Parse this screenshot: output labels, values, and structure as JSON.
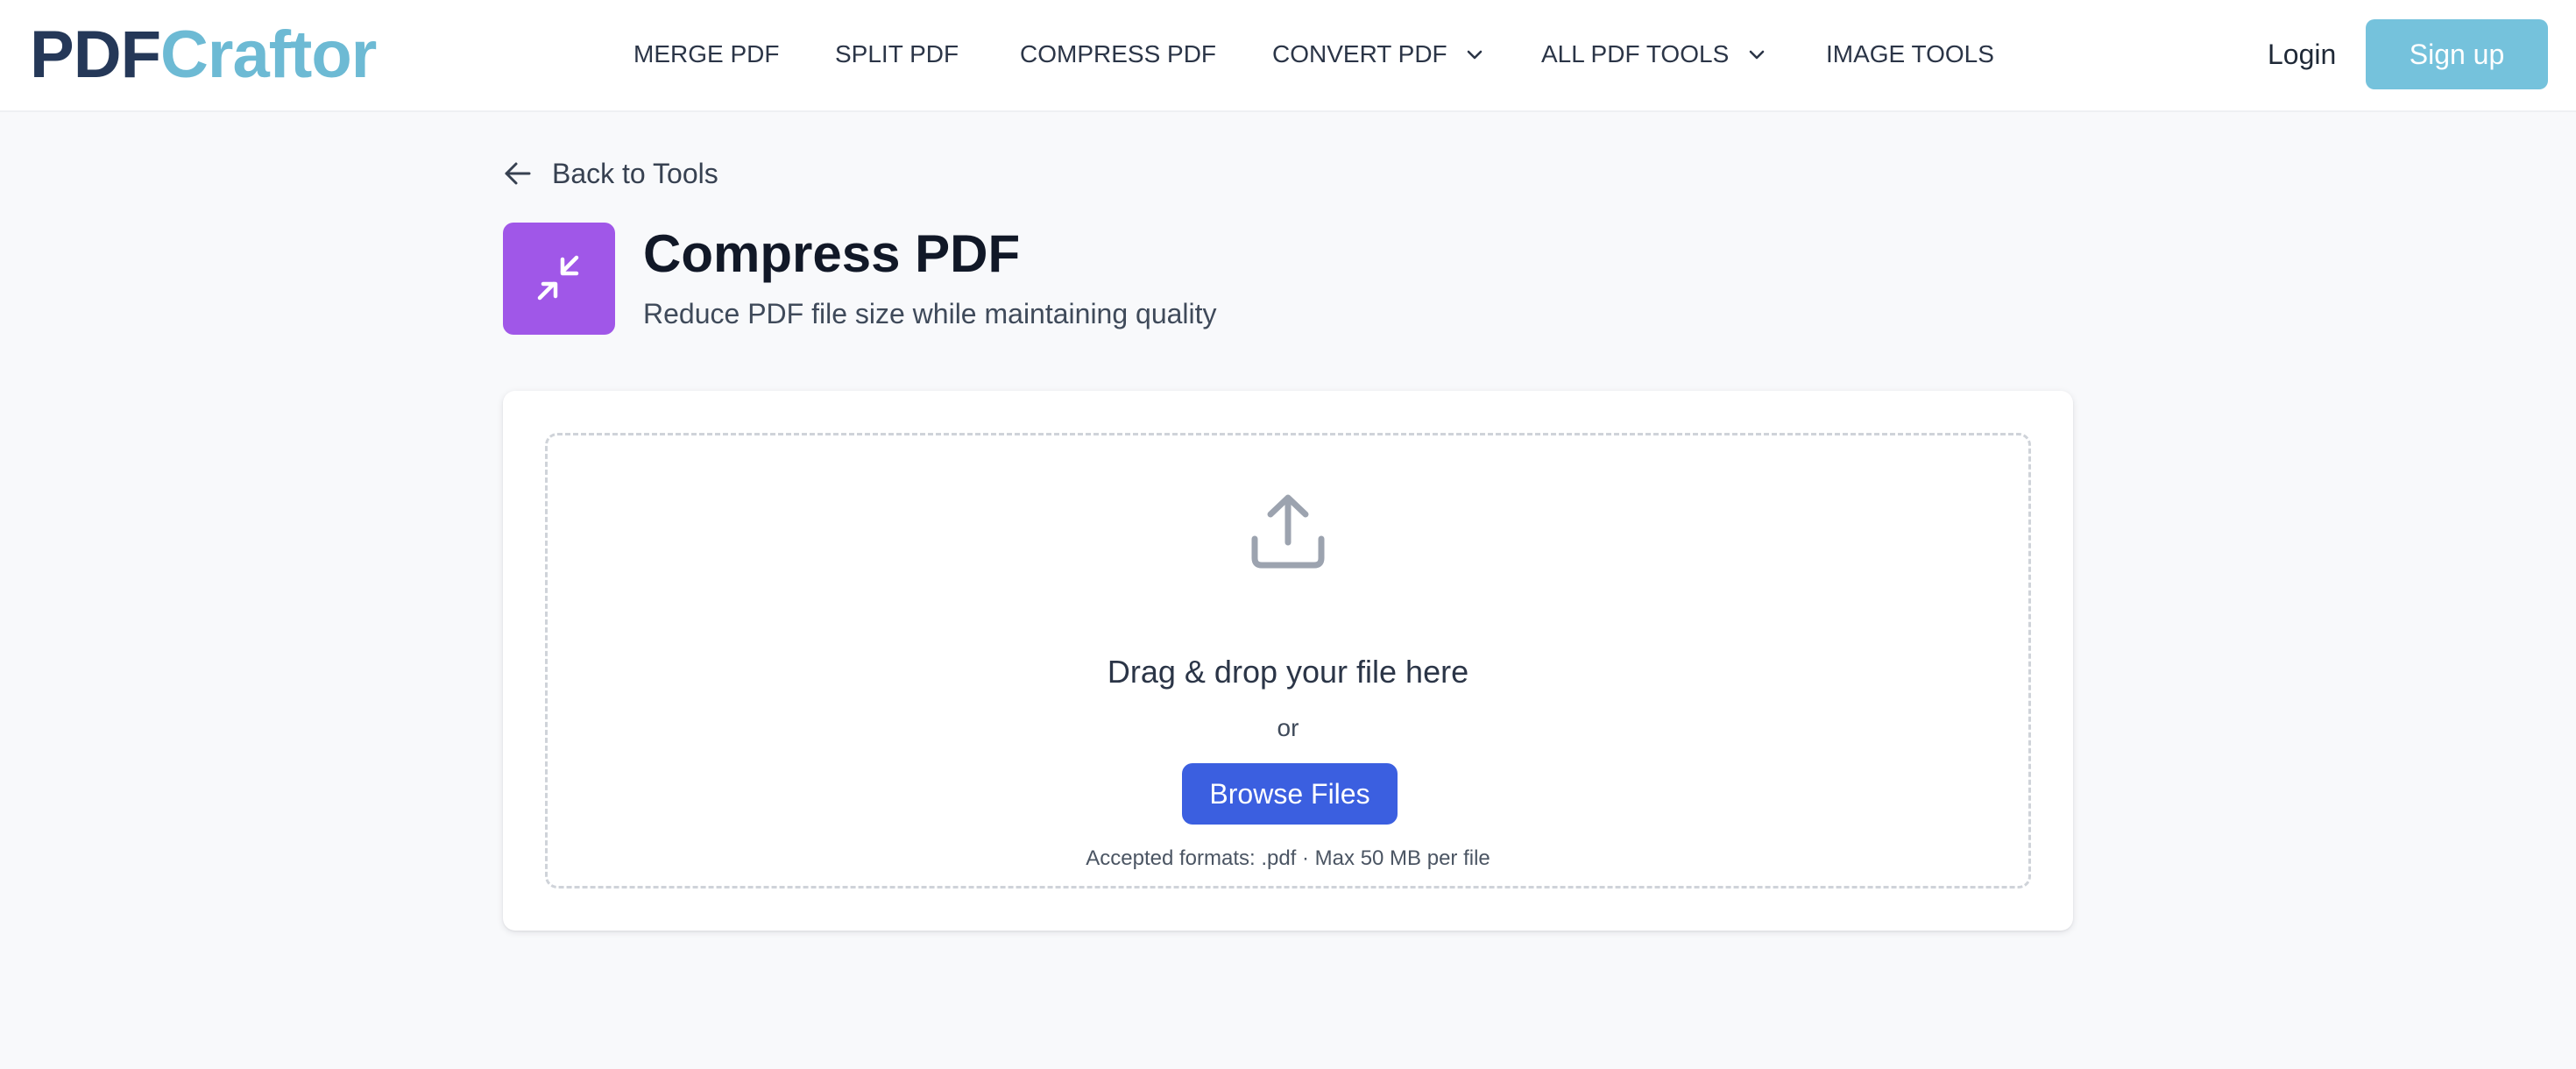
{
  "header": {
    "logo_part1": "PDF",
    "logo_part2": "Craftor",
    "nav": [
      {
        "label": "MERGE PDF",
        "has_dropdown": false
      },
      {
        "label": "SPLIT PDF",
        "has_dropdown": false
      },
      {
        "label": "COMPRESS PDF",
        "has_dropdown": false
      },
      {
        "label": "CONVERT PDF",
        "has_dropdown": true
      },
      {
        "label": "ALL PDF TOOLS",
        "has_dropdown": true
      },
      {
        "label": "IMAGE TOOLS",
        "has_dropdown": false
      }
    ],
    "login_label": "Login",
    "signup_label": "Sign up"
  },
  "back_link": {
    "label": "Back to Tools",
    "icon": "arrow-left-icon"
  },
  "tool": {
    "icon": "compress-arrows-icon",
    "title": "Compress PDF",
    "subtitle": "Reduce PDF file size while maintaining quality"
  },
  "upload": {
    "icon": "upload-icon",
    "title": "Drag & drop your file here",
    "or_text": "or",
    "browse_label": "Browse Files",
    "note": "Accepted formats: .pdf · Max 50 MB per file"
  },
  "colors": {
    "logo_dark": "#253858",
    "logo_accent": "#6dbad4",
    "signup_bg": "#75c2dc",
    "tool_icon_bg": "#a057e8",
    "browse_bg": "#3b5fe0",
    "page_bg": "#f8f9fb"
  }
}
